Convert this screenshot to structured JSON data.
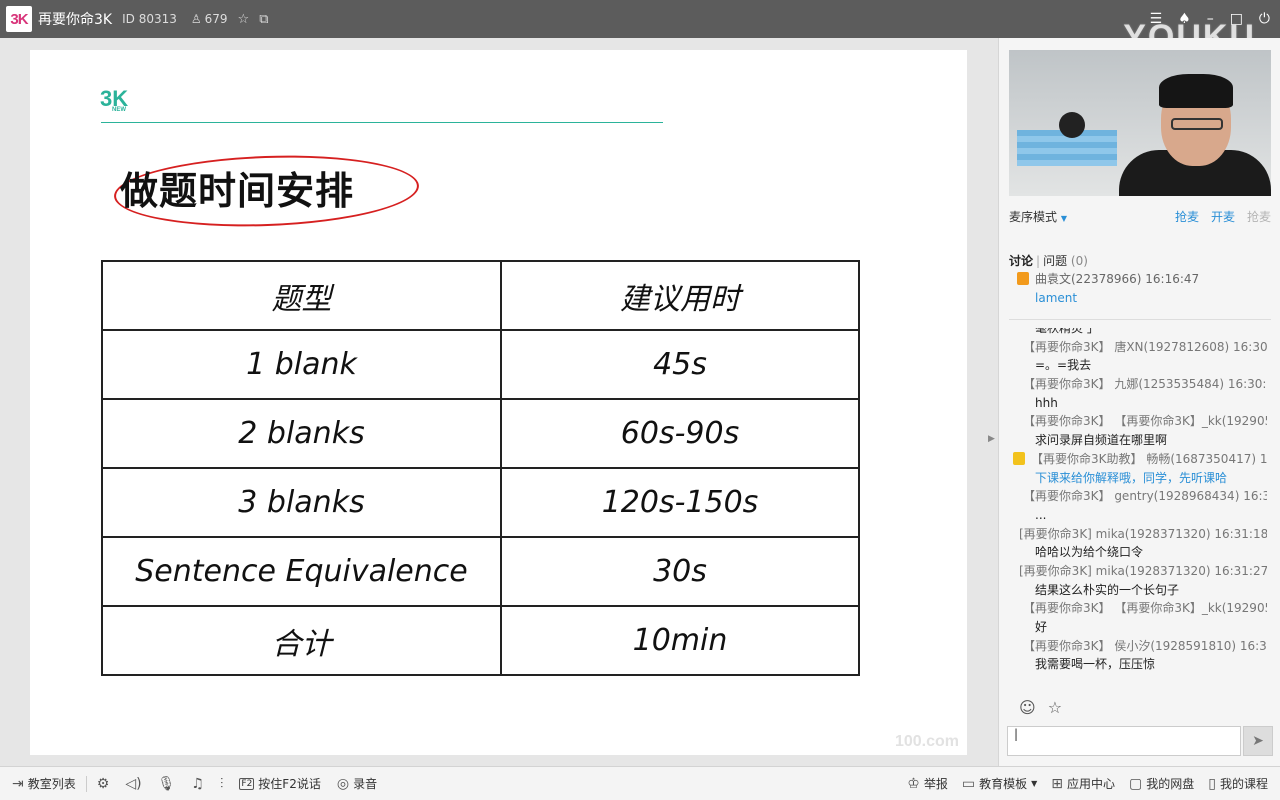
{
  "titlebar": {
    "logo": "3K",
    "room_name": "再要你命3K",
    "room_id": "ID 80313",
    "online_count": "679",
    "watermark": "YOUKU"
  },
  "slide": {
    "logo": "3K",
    "logo_sub": "NEW",
    "title": "做题时间安排",
    "table": [
      [
        "题型",
        "建议用时"
      ],
      [
        "1 blank",
        "45s"
      ],
      [
        "2 blanks",
        "60s-90s"
      ],
      [
        "3 blanks",
        "120s-150s"
      ],
      [
        "Sentence Equivalence",
        "30s"
      ],
      [
        "合计",
        "10min"
      ]
    ],
    "watermark": "100.com"
  },
  "panel": {
    "mode": "麦序模式",
    "actions": [
      "抢麦",
      "开麦",
      "抢麦"
    ],
    "tabs": {
      "discuss": "讨论",
      "questions": "问题",
      "questions_count": "(0)"
    },
    "pinned": {
      "meta": "曲袁文(22378966) 16:16:47",
      "body": "lament"
    },
    "chat": [
      {
        "type": "cut",
        "text": "毫秋精灵 」"
      },
      {
        "type": "meta",
        "text": "【再要你命3K】 唐XN(1927812608) 16:30:3"
      },
      {
        "type": "body",
        "text": "=。=我去"
      },
      {
        "type": "meta",
        "text": "【再要你命3K】 九娜(1253535484) 16:30:3"
      },
      {
        "type": "body",
        "text": "hhh"
      },
      {
        "type": "meta",
        "text": "【再要你命3K】 【再要你命3K】_kk(192905"
      },
      {
        "type": "body",
        "text": "求问录屏自频道在哪里啊"
      },
      {
        "type": "meta-gift",
        "text": "【再要你命3K助教】 畅畅(1687350417) 1"
      },
      {
        "type": "body-blue",
        "text": "下课来给你解释哦，同学，先听课哈"
      },
      {
        "type": "meta",
        "text": "【再要你命3K】 gentry(1928968434) 16:31"
      },
      {
        "type": "body",
        "text": "..."
      },
      {
        "type": "meta-shift",
        "text": "[再要你命3K] mika(1928371320) 16:31:18"
      },
      {
        "type": "body",
        "text": "哈哈以为给个绕口令"
      },
      {
        "type": "meta-shift",
        "text": "[再要你命3K] mika(1928371320) 16:31:27"
      },
      {
        "type": "body",
        "text": "结果这么朴实的一个长句子"
      },
      {
        "type": "meta",
        "text": "【再要你命3K】 【再要你命3K】_kk(192905"
      },
      {
        "type": "body",
        "text": "好"
      },
      {
        "type": "meta",
        "text": "【再要你命3K】 侯小汐(1928591810) 16:31"
      },
      {
        "type": "body",
        "text": "我需要喝一杯，压压惊"
      }
    ],
    "input_value": "|"
  },
  "bottombar": {
    "classroom_list": "教室列表",
    "speak_f2": "按住F2说话",
    "f2_key": "F2",
    "record": "录音",
    "report": "举报",
    "edu_template": "教育模板",
    "app_center": "应用中心",
    "my_disk": "我的网盘",
    "my_courses": "我的课程"
  }
}
